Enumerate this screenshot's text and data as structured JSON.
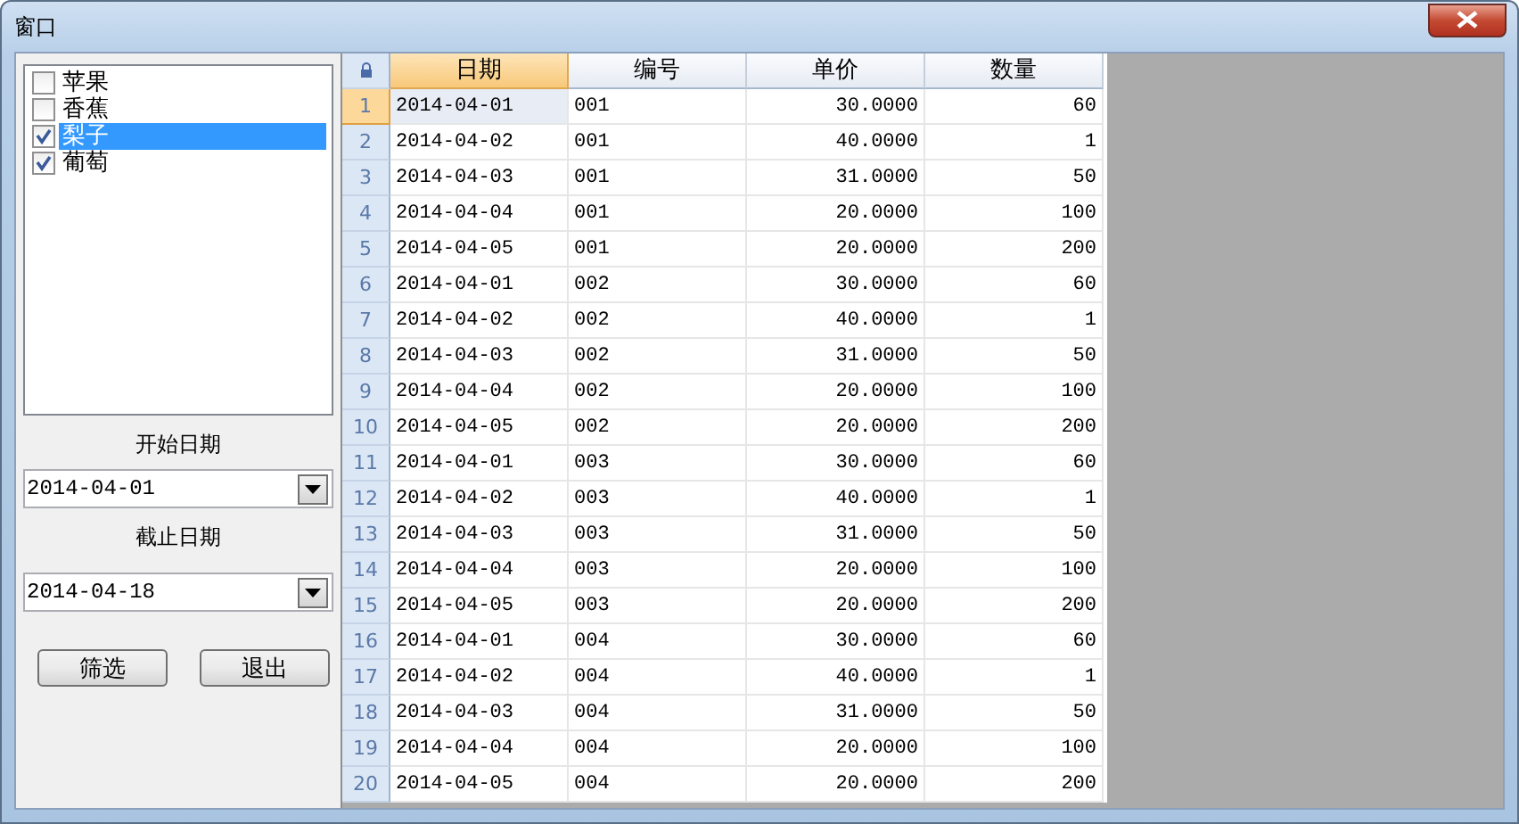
{
  "window": {
    "title": "窗口"
  },
  "fruits": [
    {
      "label": "苹果",
      "checked": false,
      "selected": false
    },
    {
      "label": "香蕉",
      "checked": false,
      "selected": false
    },
    {
      "label": "梨子",
      "checked": true,
      "selected": true
    },
    {
      "label": "葡萄",
      "checked": true,
      "selected": false
    }
  ],
  "start_date": {
    "label": "开始日期",
    "value": "2014-04-01"
  },
  "end_date": {
    "label": "截止日期",
    "value": "2014-04-18"
  },
  "buttons": [
    "筛选",
    "退出"
  ],
  "table": {
    "columns": [
      {
        "label": "日期",
        "selected": true,
        "kind": "text"
      },
      {
        "label": "编号",
        "selected": false,
        "kind": "text"
      },
      {
        "label": "单价",
        "selected": false,
        "kind": "number"
      },
      {
        "label": "数量",
        "selected": false,
        "kind": "number"
      }
    ],
    "rows": [
      {
        "num": "1",
        "selected": true,
        "cells": [
          "2014-04-01",
          "001",
          "30.0000",
          "60"
        ]
      },
      {
        "num": "2",
        "selected": false,
        "cells": [
          "2014-04-02",
          "001",
          "40.0000",
          "1"
        ]
      },
      {
        "num": "3",
        "selected": false,
        "cells": [
          "2014-04-03",
          "001",
          "31.0000",
          "50"
        ]
      },
      {
        "num": "4",
        "selected": false,
        "cells": [
          "2014-04-04",
          "001",
          "20.0000",
          "100"
        ]
      },
      {
        "num": "5",
        "selected": false,
        "cells": [
          "2014-04-05",
          "001",
          "20.0000",
          "200"
        ]
      },
      {
        "num": "6",
        "selected": false,
        "cells": [
          "2014-04-01",
          "002",
          "30.0000",
          "60"
        ]
      },
      {
        "num": "7",
        "selected": false,
        "cells": [
          "2014-04-02",
          "002",
          "40.0000",
          "1"
        ]
      },
      {
        "num": "8",
        "selected": false,
        "cells": [
          "2014-04-03",
          "002",
          "31.0000",
          "50"
        ]
      },
      {
        "num": "9",
        "selected": false,
        "cells": [
          "2014-04-04",
          "002",
          "20.0000",
          "100"
        ]
      },
      {
        "num": "10",
        "selected": false,
        "cells": [
          "2014-04-05",
          "002",
          "20.0000",
          "200"
        ]
      },
      {
        "num": "11",
        "selected": false,
        "cells": [
          "2014-04-01",
          "003",
          "30.0000",
          "60"
        ]
      },
      {
        "num": "12",
        "selected": false,
        "cells": [
          "2014-04-02",
          "003",
          "40.0000",
          "1"
        ]
      },
      {
        "num": "13",
        "selected": false,
        "cells": [
          "2014-04-03",
          "003",
          "31.0000",
          "50"
        ]
      },
      {
        "num": "14",
        "selected": false,
        "cells": [
          "2014-04-04",
          "003",
          "20.0000",
          "100"
        ]
      },
      {
        "num": "15",
        "selected": false,
        "cells": [
          "2014-04-05",
          "003",
          "20.0000",
          "200"
        ]
      },
      {
        "num": "16",
        "selected": false,
        "cells": [
          "2014-04-01",
          "004",
          "30.0000",
          "60"
        ]
      },
      {
        "num": "17",
        "selected": false,
        "cells": [
          "2014-04-02",
          "004",
          "40.0000",
          "1"
        ]
      },
      {
        "num": "18",
        "selected": false,
        "cells": [
          "2014-04-03",
          "004",
          "31.0000",
          "50"
        ]
      },
      {
        "num": "19",
        "selected": false,
        "cells": [
          "2014-04-04",
          "004",
          "20.0000",
          "100"
        ]
      },
      {
        "num": "20",
        "selected": false,
        "cells": [
          "2014-04-05",
          "004",
          "20.0000",
          "200"
        ]
      }
    ]
  }
}
